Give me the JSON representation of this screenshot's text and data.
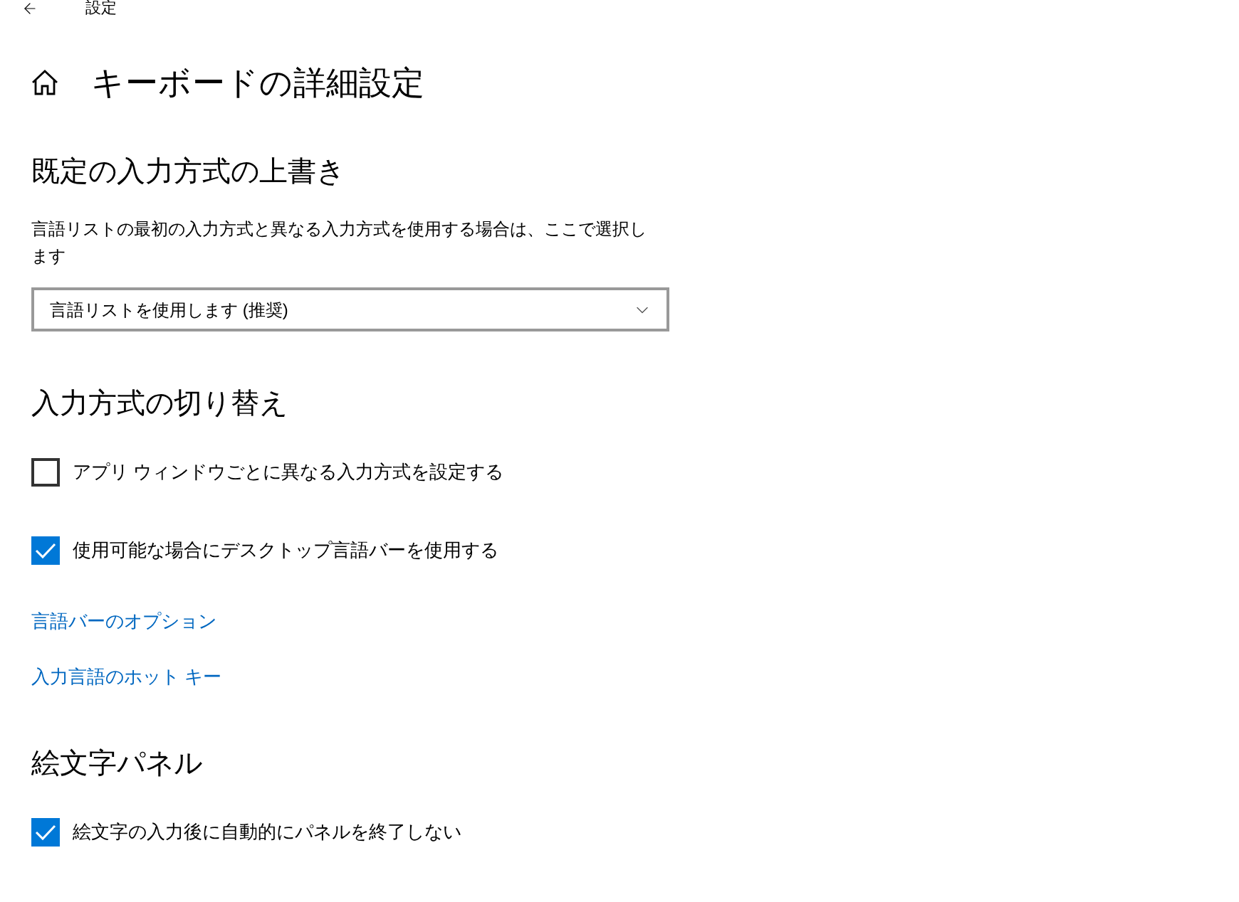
{
  "window": {
    "title": "設定"
  },
  "page": {
    "title": "キーボードの詳細設定"
  },
  "sections": [
    {
      "heading": "既定の入力方式の上書き",
      "items": [
        {
          "kind": "description",
          "text": "言語リストの最初の入力方式と異なる入力方式を使用する場合は、ここで選択します"
        },
        {
          "kind": "dropdown",
          "value": "言語リストを使用します (推奨)"
        }
      ]
    },
    {
      "heading": "入力方式の切り替え",
      "items": [
        {
          "kind": "checkbox",
          "label": "アプリ ウィンドウごとに異なる入力方式を設定する",
          "checked": false
        },
        {
          "kind": "checkbox",
          "label": "使用可能な場合にデスクトップ言語バーを使用する",
          "checked": true
        },
        {
          "kind": "link",
          "label": "言語バーのオプション"
        },
        {
          "kind": "link",
          "label": "入力言語のホット キー"
        }
      ]
    },
    {
      "heading": "絵文字パネル",
      "items": [
        {
          "kind": "checkbox",
          "label": "絵文字の入力後に自動的にパネルを終了しない",
          "checked": true
        }
      ]
    }
  ]
}
